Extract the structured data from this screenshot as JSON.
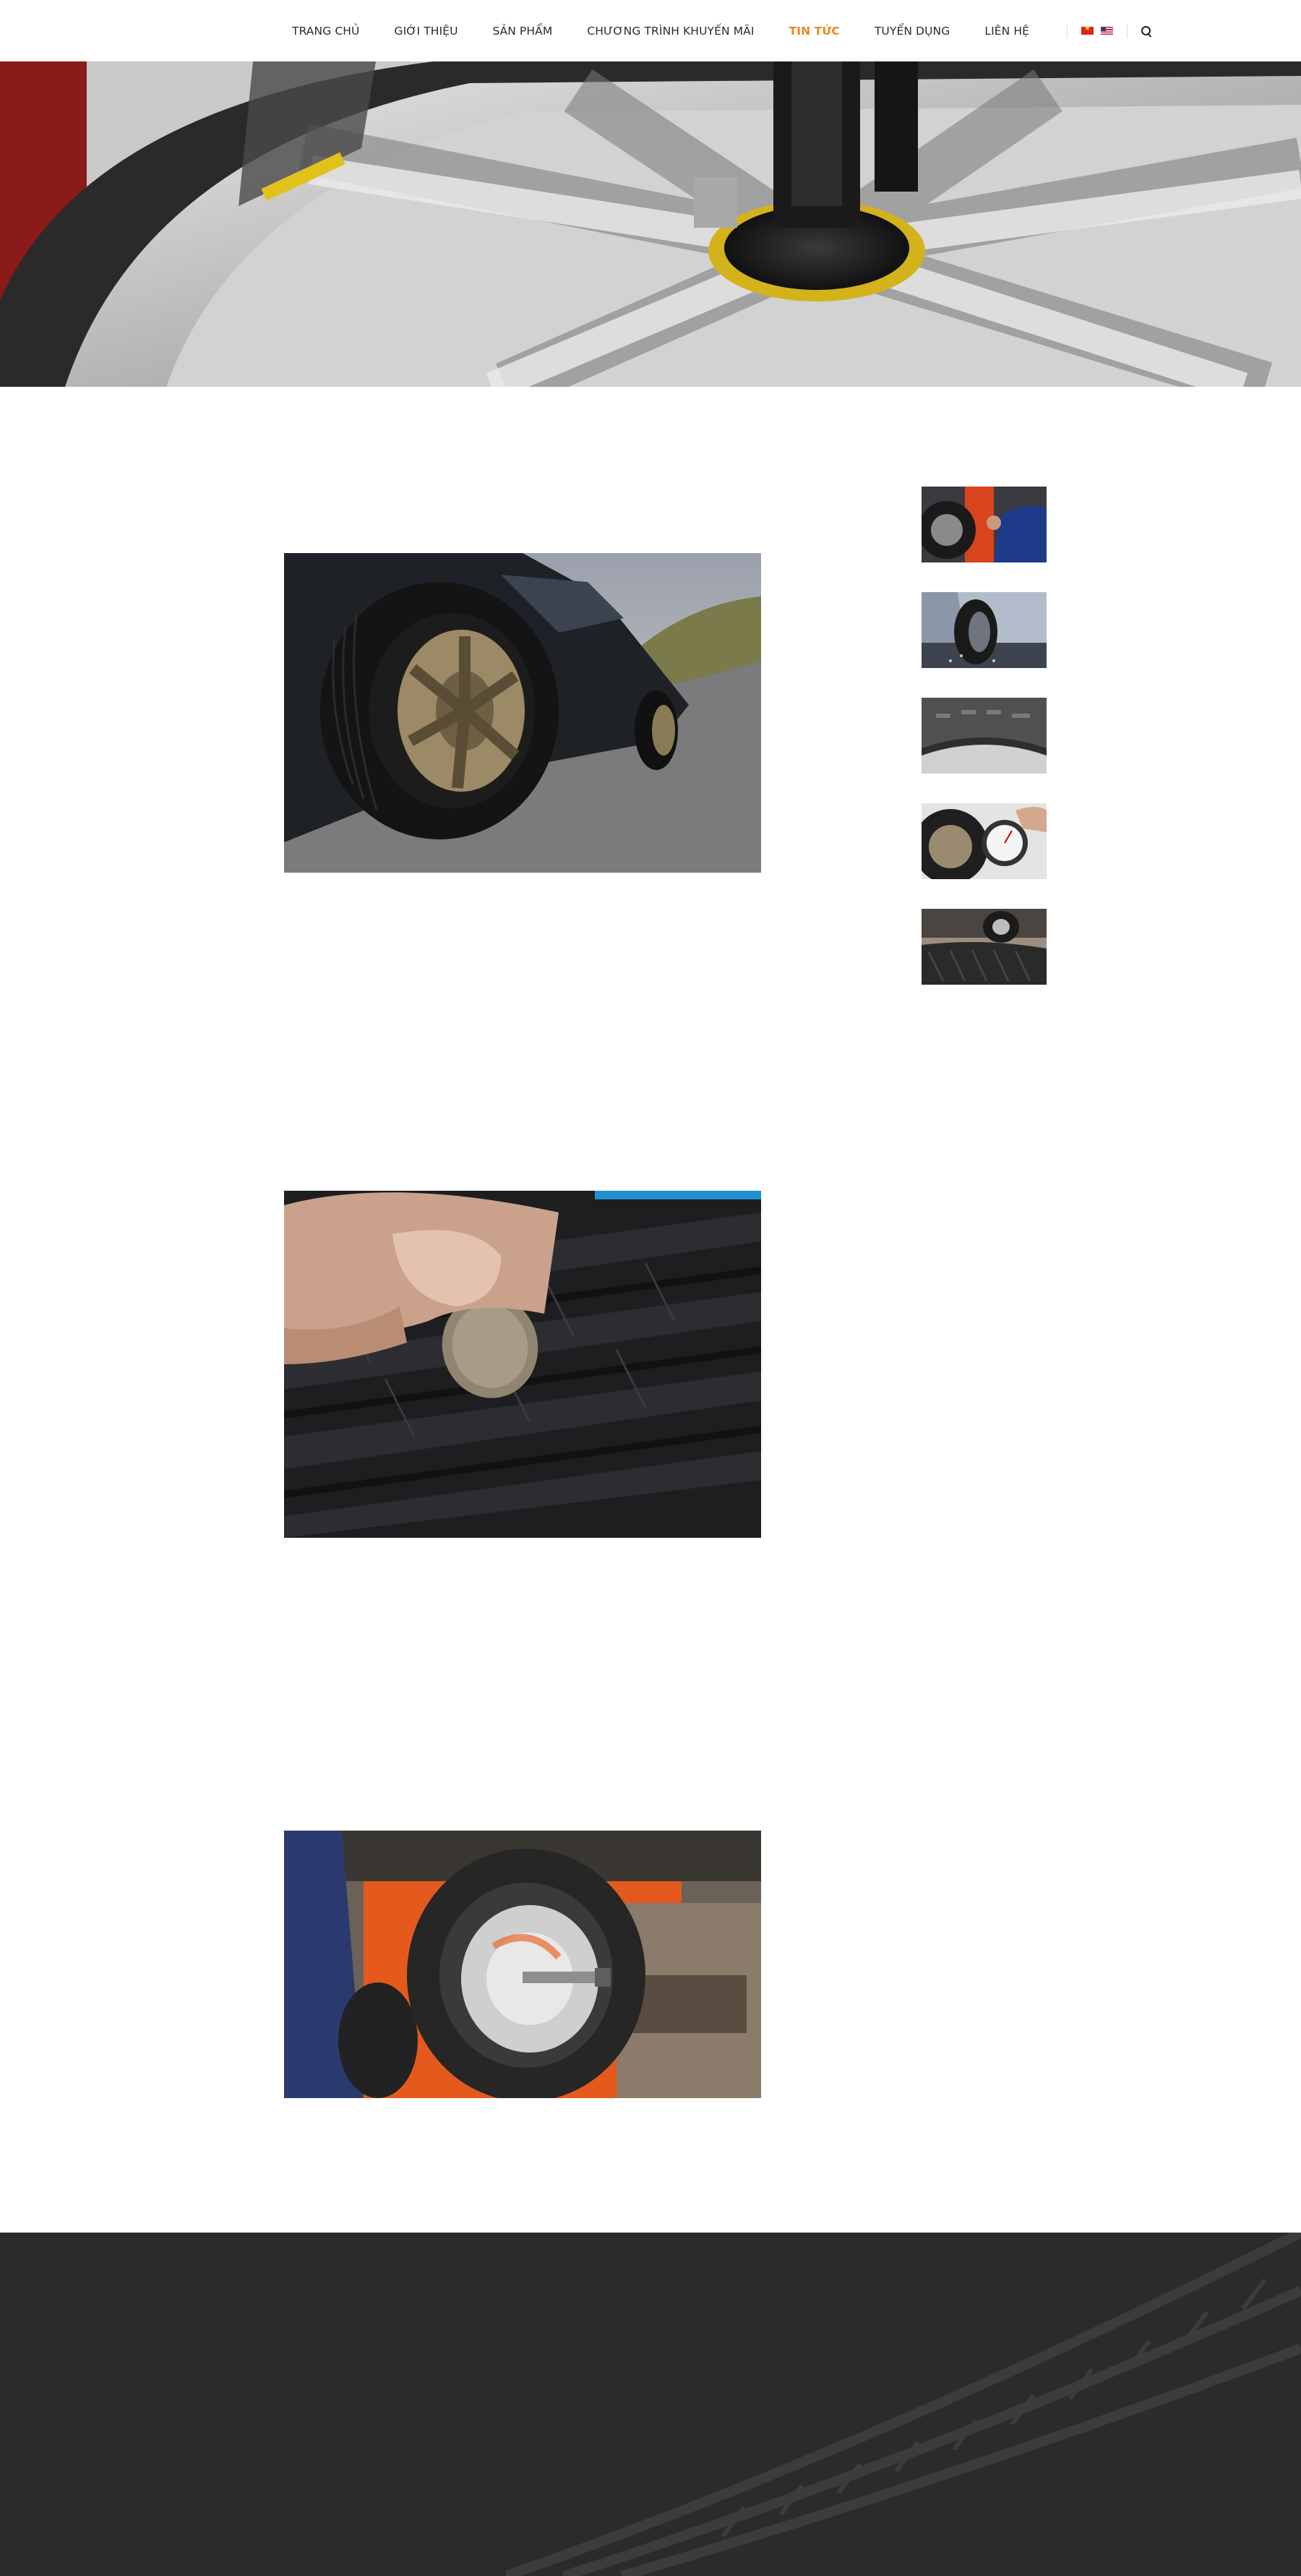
{
  "nav": {
    "items": [
      {
        "label": "TRANG CHỦ",
        "active": false
      },
      {
        "label": "GIỚI THIỆU",
        "active": false
      },
      {
        "label": "SẢN PHẨM",
        "active": false
      },
      {
        "label": "CHƯƠNG TRÌNH KHUYẾN MÃI",
        "active": false
      },
      {
        "label": "TIN TỨC",
        "active": true
      },
      {
        "label": "TUYỂN DỤNG",
        "active": false
      },
      {
        "label": "LIÊN HỆ",
        "active": false
      }
    ],
    "languages": [
      "vietnamese-flag-icon",
      "english-flag-icon"
    ],
    "search_icon": "search-icon"
  },
  "colors": {
    "accent": "#e8891e",
    "nav_text": "#2b2b2b",
    "footer_bg": "#2b2b2c"
  },
  "hero": {
    "image": "tire-changing-machine-on-alloy-wheel"
  },
  "articles": [
    {
      "image": "car-tire-on-road-photo"
    },
    {
      "image": "coin-in-tire-tread-photo"
    },
    {
      "image": "wheel-balancing-machine-photo"
    }
  ],
  "sidebar": {
    "thumbnails": [
      {
        "image": "mechanic-working-on-wheel-thumbnail"
      },
      {
        "image": "car-tire-on-wet-road-thumbnail"
      },
      {
        "image": "tire-sidewall-lettering-thumbnail"
      },
      {
        "image": "tire-pressure-gauge-thumbnail"
      },
      {
        "image": "tire-on-workshop-floor-thumbnail"
      }
    ]
  }
}
